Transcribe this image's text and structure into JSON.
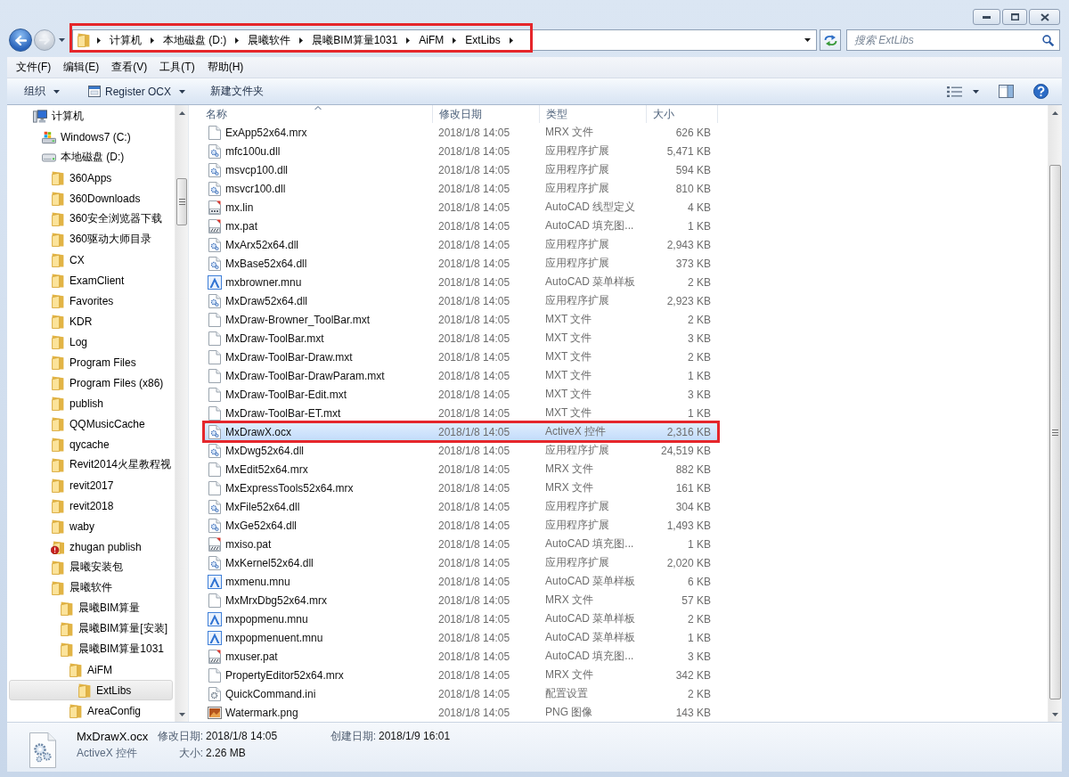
{
  "navigation": [
    {
      "kind": "back",
      "disabled": false
    },
    {
      "kind": "forward",
      "disabled": true
    }
  ],
  "address_bar": {
    "annotated": true,
    "crumbs": [
      "计算机",
      "本地磁盘 (D:)",
      "晨曦软件",
      "晨曦BIM算量1031",
      "AiFM",
      "ExtLibs"
    ]
  },
  "search": {
    "placeholder": "搜索 ExtLibs"
  },
  "menu_bar": [
    "文件(F)",
    "编辑(E)",
    "查看(V)",
    "工具(T)",
    "帮助(H)"
  ],
  "toolbar": {
    "buttons": [
      {
        "label": "组织",
        "kind": "text",
        "dropdown": true
      },
      {
        "label": "Register OCX",
        "kind": "icon",
        "dropdown": true
      },
      {
        "label": "新建文件夹",
        "kind": "text",
        "dropdown": false
      }
    ]
  },
  "nav": {
    "tree": [
      {
        "label": "计算机",
        "kind": "computer",
        "selected": false,
        "children": [
          {
            "label": "Windows7 (C:)",
            "kind": "system-drive",
            "selected": false
          },
          {
            "label": "本地磁盘 (D:)",
            "kind": "drive",
            "selected": false,
            "children": [
              {
                "label": "360Apps",
                "kind": "folder",
                "selected": false
              },
              {
                "label": "360Downloads",
                "kind": "folder",
                "selected": false
              },
              {
                "label": "360安全浏览器下载",
                "kind": "folder",
                "selected": false
              },
              {
                "label": "360驱动大师目录",
                "kind": "folder",
                "selected": false
              },
              {
                "label": "CX",
                "kind": "folder",
                "selected": false
              },
              {
                "label": "ExamClient",
                "kind": "folder",
                "selected": false
              },
              {
                "label": "Favorites",
                "kind": "folder",
                "selected": false
              },
              {
                "label": "KDR",
                "kind": "folder",
                "selected": false
              },
              {
                "label": "Log",
                "kind": "folder",
                "selected": false
              },
              {
                "label": "Program Files",
                "kind": "folder",
                "selected": false
              },
              {
                "label": "Program Files (x86)",
                "kind": "folder",
                "selected": false
              },
              {
                "label": "publish",
                "kind": "folder",
                "selected": false
              },
              {
                "label": "QQMusicCache",
                "kind": "folder",
                "selected": false
              },
              {
                "label": "qycache",
                "kind": "folder",
                "selected": false
              },
              {
                "label": "Revit2014火星教程视",
                "kind": "folder",
                "selected": false
              },
              {
                "label": "revit2017",
                "kind": "folder",
                "selected": false
              },
              {
                "label": "revit2018",
                "kind": "folder",
                "selected": false
              },
              {
                "label": "waby",
                "kind": "folder",
                "selected": false
              },
              {
                "label": "zhugan publish",
                "kind": "folder-alert",
                "selected": false
              },
              {
                "label": "晨曦安装包",
                "kind": "folder",
                "selected": false
              },
              {
                "label": "晨曦软件",
                "kind": "folder",
                "selected": false,
                "children": [
                  {
                    "label": "晨曦BIM算量",
                    "kind": "folder",
                    "selected": false
                  },
                  {
                    "label": "晨曦BIM算量[安装]",
                    "kind": "folder",
                    "selected": false
                  },
                  {
                    "label": "晨曦BIM算量1031",
                    "kind": "folder",
                    "selected": false,
                    "children": [
                      {
                        "label": "AiFM",
                        "kind": "folder",
                        "selected": false,
                        "children": [
                          {
                            "label": "ExtLibs",
                            "kind": "folder",
                            "selected": true
                          }
                        ]
                      },
                      {
                        "label": "AreaConfig",
                        "kind": "folder",
                        "selected": false
                      }
                    ]
                  }
                ]
              }
            ]
          }
        ]
      }
    ]
  },
  "file_list": {
    "columns": [
      {
        "label": "名称",
        "sorted": true
      },
      {
        "label": "修改日期",
        "sorted": false
      },
      {
        "label": "类型",
        "sorted": false
      },
      {
        "label": "大小",
        "sorted": false
      }
    ],
    "rows": [
      {
        "name": "ExApp52x64.mrx",
        "date": "2018/1/8 14:05",
        "type": "MRX 文件",
        "size": "626 KB",
        "kind": "blank",
        "selected": false,
        "annotated": false
      },
      {
        "name": "mfc100u.dll",
        "date": "2018/1/8 14:05",
        "type": "应用程序扩展",
        "size": "5,471 KB",
        "kind": "library",
        "selected": false,
        "annotated": false
      },
      {
        "name": "msvcp100.dll",
        "date": "2018/1/8 14:05",
        "type": "应用程序扩展",
        "size": "594 KB",
        "kind": "library",
        "selected": false,
        "annotated": false
      },
      {
        "name": "msvcr100.dll",
        "date": "2018/1/8 14:05",
        "type": "应用程序扩展",
        "size": "810 KB",
        "kind": "library",
        "selected": false,
        "annotated": false
      },
      {
        "name": "mx.lin",
        "date": "2018/1/8 14:05",
        "type": "AutoCAD 线型定义",
        "size": "4 KB",
        "kind": "linetype",
        "selected": false,
        "annotated": false
      },
      {
        "name": "mx.pat",
        "date": "2018/1/8 14:05",
        "type": "AutoCAD 填充图...",
        "size": "1 KB",
        "kind": "hatch",
        "selected": false,
        "annotated": false
      },
      {
        "name": "MxArx52x64.dll",
        "date": "2018/1/8 14:05",
        "type": "应用程序扩展",
        "size": "2,943 KB",
        "kind": "library",
        "selected": false,
        "annotated": false
      },
      {
        "name": "MxBase52x64.dll",
        "date": "2018/1/8 14:05",
        "type": "应用程序扩展",
        "size": "373 KB",
        "kind": "library",
        "selected": false,
        "annotated": false
      },
      {
        "name": "mxbrowner.mnu",
        "date": "2018/1/8 14:05",
        "type": "AutoCAD 菜单样板",
        "size": "2 KB",
        "kind": "menu",
        "selected": false,
        "annotated": false
      },
      {
        "name": "MxDraw52x64.dll",
        "date": "2018/1/8 14:05",
        "type": "应用程序扩展",
        "size": "2,923 KB",
        "kind": "library",
        "selected": false,
        "annotated": false
      },
      {
        "name": "MxDraw-Browner_ToolBar.mxt",
        "date": "2018/1/8 14:05",
        "type": "MXT 文件",
        "size": "2 KB",
        "kind": "blank",
        "selected": false,
        "annotated": false
      },
      {
        "name": "MxDraw-ToolBar.mxt",
        "date": "2018/1/8 14:05",
        "type": "MXT 文件",
        "size": "3 KB",
        "kind": "blank",
        "selected": false,
        "annotated": false
      },
      {
        "name": "MxDraw-ToolBar-Draw.mxt",
        "date": "2018/1/8 14:05",
        "type": "MXT 文件",
        "size": "2 KB",
        "kind": "blank",
        "selected": false,
        "annotated": false
      },
      {
        "name": "MxDraw-ToolBar-DrawParam.mxt",
        "date": "2018/1/8 14:05",
        "type": "MXT 文件",
        "size": "1 KB",
        "kind": "blank",
        "selected": false,
        "annotated": false
      },
      {
        "name": "MxDraw-ToolBar-Edit.mxt",
        "date": "2018/1/8 14:05",
        "type": "MXT 文件",
        "size": "3 KB",
        "kind": "blank",
        "selected": false,
        "annotated": false
      },
      {
        "name": "MxDraw-ToolBar-ET.mxt",
        "date": "2018/1/8 14:05",
        "type": "MXT 文件",
        "size": "1 KB",
        "kind": "blank",
        "selected": false,
        "annotated": false
      },
      {
        "name": "MxDrawX.ocx",
        "date": "2018/1/8 14:05",
        "type": "ActiveX 控件",
        "size": "2,316 KB",
        "kind": "library",
        "selected": true,
        "annotated": true
      },
      {
        "name": "MxDwg52x64.dll",
        "date": "2018/1/8 14:05",
        "type": "应用程序扩展",
        "size": "24,519 KB",
        "kind": "library",
        "selected": false,
        "annotated": false
      },
      {
        "name": "MxEdit52x64.mrx",
        "date": "2018/1/8 14:05",
        "type": "MRX 文件",
        "size": "882 KB",
        "kind": "blank",
        "selected": false,
        "annotated": false
      },
      {
        "name": "MxExpressTools52x64.mrx",
        "date": "2018/1/8 14:05",
        "type": "MRX 文件",
        "size": "161 KB",
        "kind": "blank",
        "selected": false,
        "annotated": false
      },
      {
        "name": "MxFile52x64.dll",
        "date": "2018/1/8 14:05",
        "type": "应用程序扩展",
        "size": "304 KB",
        "kind": "library",
        "selected": false,
        "annotated": false
      },
      {
        "name": "MxGe52x64.dll",
        "date": "2018/1/8 14:05",
        "type": "应用程序扩展",
        "size": "1,493 KB",
        "kind": "library",
        "selected": false,
        "annotated": false
      },
      {
        "name": "mxiso.pat",
        "date": "2018/1/8 14:05",
        "type": "AutoCAD 填充图...",
        "size": "1 KB",
        "kind": "hatch",
        "selected": false,
        "annotated": false
      },
      {
        "name": "MxKernel52x64.dll",
        "date": "2018/1/8 14:05",
        "type": "应用程序扩展",
        "size": "2,020 KB",
        "kind": "library",
        "selected": false,
        "annotated": false
      },
      {
        "name": "mxmenu.mnu",
        "date": "2018/1/8 14:05",
        "type": "AutoCAD 菜单样板",
        "size": "6 KB",
        "kind": "menu",
        "selected": false,
        "annotated": false
      },
      {
        "name": "MxMrxDbg52x64.mrx",
        "date": "2018/1/8 14:05",
        "type": "MRX 文件",
        "size": "57 KB",
        "kind": "blank",
        "selected": false,
        "annotated": false
      },
      {
        "name": "mxpopmenu.mnu",
        "date": "2018/1/8 14:05",
        "type": "AutoCAD 菜单样板",
        "size": "2 KB",
        "kind": "menu",
        "selected": false,
        "annotated": false
      },
      {
        "name": "mxpopmenuent.mnu",
        "date": "2018/1/8 14:05",
        "type": "AutoCAD 菜单样板",
        "size": "1 KB",
        "kind": "menu",
        "selected": false,
        "annotated": false
      },
      {
        "name": "mxuser.pat",
        "date": "2018/1/8 14:05",
        "type": "AutoCAD 填充图...",
        "size": "3 KB",
        "kind": "hatch",
        "selected": false,
        "annotated": false
      },
      {
        "name": "PropertyEditor52x64.mrx",
        "date": "2018/1/8 14:05",
        "type": "MRX 文件",
        "size": "342 KB",
        "kind": "blank",
        "selected": false,
        "annotated": false
      },
      {
        "name": "QuickCommand.ini",
        "date": "2018/1/8 14:05",
        "type": "配置设置",
        "size": "2 KB",
        "kind": "config",
        "selected": false,
        "annotated": false
      },
      {
        "name": "Watermark.png",
        "date": "2018/1/8 14:05",
        "type": "PNG 图像",
        "size": "143 KB",
        "kind": "image",
        "selected": false,
        "annotated": false
      }
    ]
  },
  "details": {
    "lines": [
      {
        "text": "MxDrawX.ocx",
        "fields": [
          {
            "label": "修改日期:",
            "value": "2018/1/8 14:05"
          },
          {
            "label": "创建日期:",
            "value": "2018/1/9 16:01"
          }
        ]
      },
      {
        "text": "ActiveX 控件",
        "fields": [
          {
            "label": "大小:",
            "value": "2.26 MB"
          }
        ]
      }
    ]
  }
}
